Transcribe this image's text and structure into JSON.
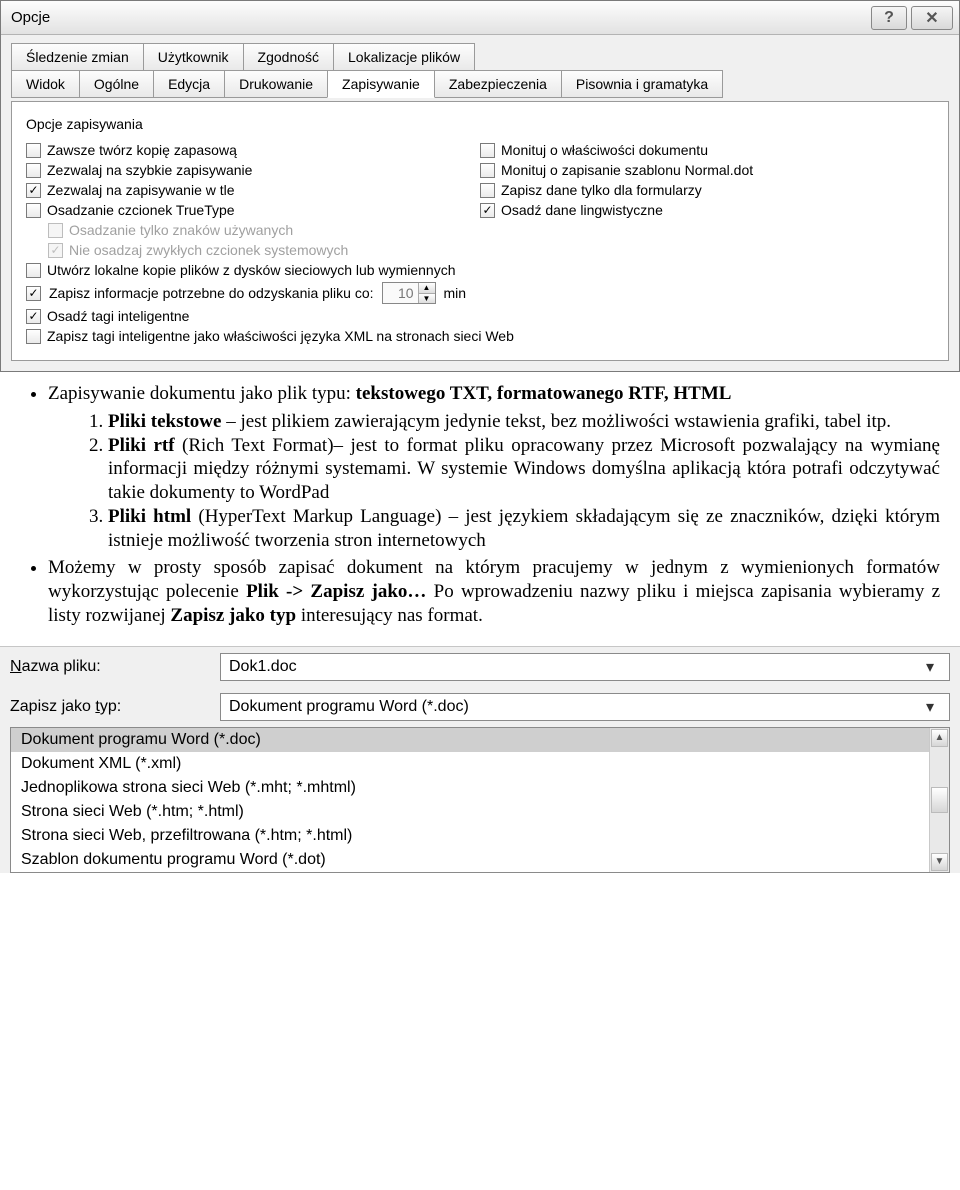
{
  "dialog": {
    "title": "Opcje",
    "tabs_row1": [
      "Śledzenie zmian",
      "Użytkownik",
      "Zgodność",
      "Lokalizacje plików"
    ],
    "tabs_row2": [
      "Widok",
      "Ogólne",
      "Edycja",
      "Drukowanie",
      "Zapisywanie",
      "Zabezpieczenia",
      "Pisownia i gramatyka"
    ],
    "active_tab": "Zapisywanie",
    "group_label": "Opcje zapisywania",
    "left_options": [
      {
        "checked": false,
        "label": "Zawsze twórz kopię zapasową",
        "ul": "k"
      },
      {
        "checked": false,
        "label": "Zezwalaj na szybkie zapisywanie",
        "ul": "e"
      },
      {
        "checked": true,
        "label": "Zezwalaj na zapisywanie w tle",
        "ul": "Z"
      },
      {
        "checked": false,
        "label": "Osadzanie czcionek TrueType",
        "ul": "T"
      }
    ],
    "left_sub_options": [
      {
        "checked": false,
        "disabled": true,
        "label": "Osadzanie tylko znaków używanych",
        "ul": "u"
      },
      {
        "checked": true,
        "disabled": true,
        "label": "Nie osadzaj zwykłych czcionek systemowych"
      }
    ],
    "right_options": [
      {
        "checked": false,
        "label": "Monituj o właściwości dokumentu",
        "ul": "w"
      },
      {
        "checked": false,
        "label": "Monituj o zapisanie szablonu Normal.dot",
        "ul": "t"
      },
      {
        "checked": false,
        "label": "Zapisz dane tylko dla formularzy",
        "ul": "u"
      },
      {
        "checked": true,
        "label": "Osadź dane lingwistyczne",
        "ul": "g"
      }
    ],
    "lower_options": [
      {
        "checked": false,
        "label": "Utwórz lokalne kopie plików z dysków sieciowych lub wymiennych",
        "ul": "d"
      }
    ],
    "recovery": {
      "checked": true,
      "label": "Zapisz informacje potrzebne do odzyskania pliku co:",
      "ul": "i",
      "value": "10",
      "unit": "min",
      "unit_ul": "m"
    },
    "lower_options2": [
      {
        "checked": true,
        "label": "Osadź tagi inteligentne",
        "ul": "t"
      },
      {
        "checked": false,
        "label": "Zapisz tagi inteligentne jako właściwości języka XML na stronach sieci Web"
      }
    ]
  },
  "article": {
    "bullet1": "Zapisywanie dokumentu jako plik typu: tekstowego TXT, formatowanego RTF, HTML",
    "li1": "Pliki tekstowe – jest plikiem zawierającym jedynie tekst, bez możliwości wstawienia grafiki, tabel itp.",
    "li2": "Pliki rtf  (Rich Text Format)– jest to format pliku opracowany przez Microsoft pozwalający na wymianę informacji między różnymi systemami. W systemie Windows domyślna aplikacją która potrafi odczytywać takie dokumenty to WordPad",
    "li3": "Pliki html (HyperText Markup Language) – jest językiem składającym się ze znaczników, dzięki którym istnieje możliwość tworzenia stron internetowych",
    "bullet2": "Możemy w prosty sposób zapisać dokument na którym pracujemy w jednym z wymienionych formatów wykorzystując polecenie Plik -> Zapisz jako… Po wprowadzeniu nazwy pliku i miejsca zapisania wybieramy z listy rozwijanej Zapisz jako typ interesujący nas format."
  },
  "saveas": {
    "name_label": "Nazwa pliku:",
    "name_ul": "N",
    "name_value": "Dok1.doc",
    "type_label": "Zapisz jako typ:",
    "type_ul": "t",
    "type_value": "Dokument programu Word (*.doc)",
    "options": [
      "Dokument programu Word (*.doc)",
      "Dokument XML (*.xml)",
      "Jednoplikowa strona sieci Web (*.mht; *.mhtml)",
      "Strona sieci Web (*.htm; *.html)",
      "Strona sieci Web, przefiltrowana (*.htm; *.html)",
      "Szablon dokumentu programu Word (*.dot)"
    ]
  }
}
